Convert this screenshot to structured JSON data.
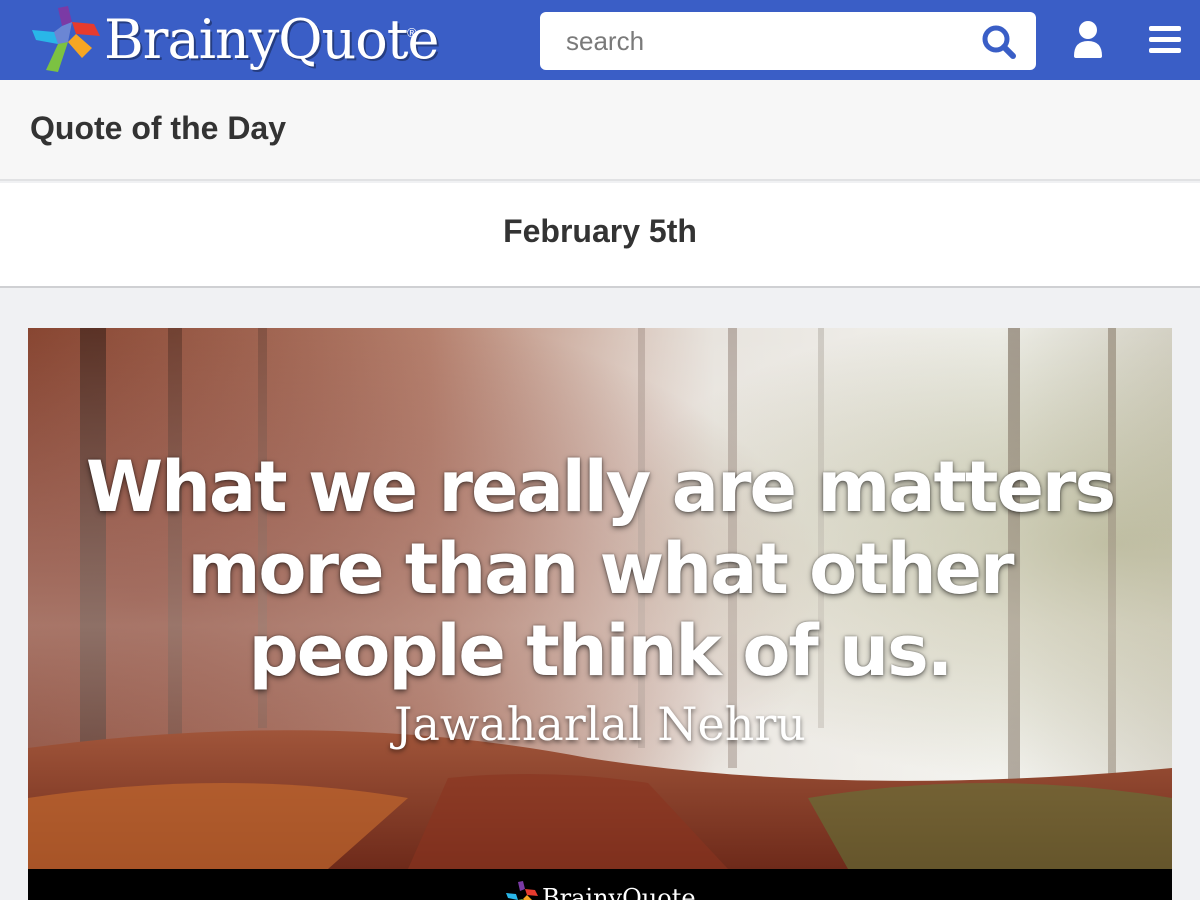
{
  "header": {
    "logo_text": "BrainyQuote",
    "logo_registered": "®",
    "search_placeholder": "search",
    "icons": {
      "search": "search-icon",
      "user": "user-icon",
      "menu": "hamburger-menu-icon"
    },
    "colors": {
      "bar": "#3a5ec6",
      "search_icon": "#3a5ec6"
    }
  },
  "section": {
    "title": "Quote of the Day"
  },
  "date": "February 5th",
  "quote": {
    "text": "What we really are matters more than what other people think of us.",
    "author": "Jawaharlal Nehru",
    "footer_logo_text": "BrainyQuote"
  }
}
